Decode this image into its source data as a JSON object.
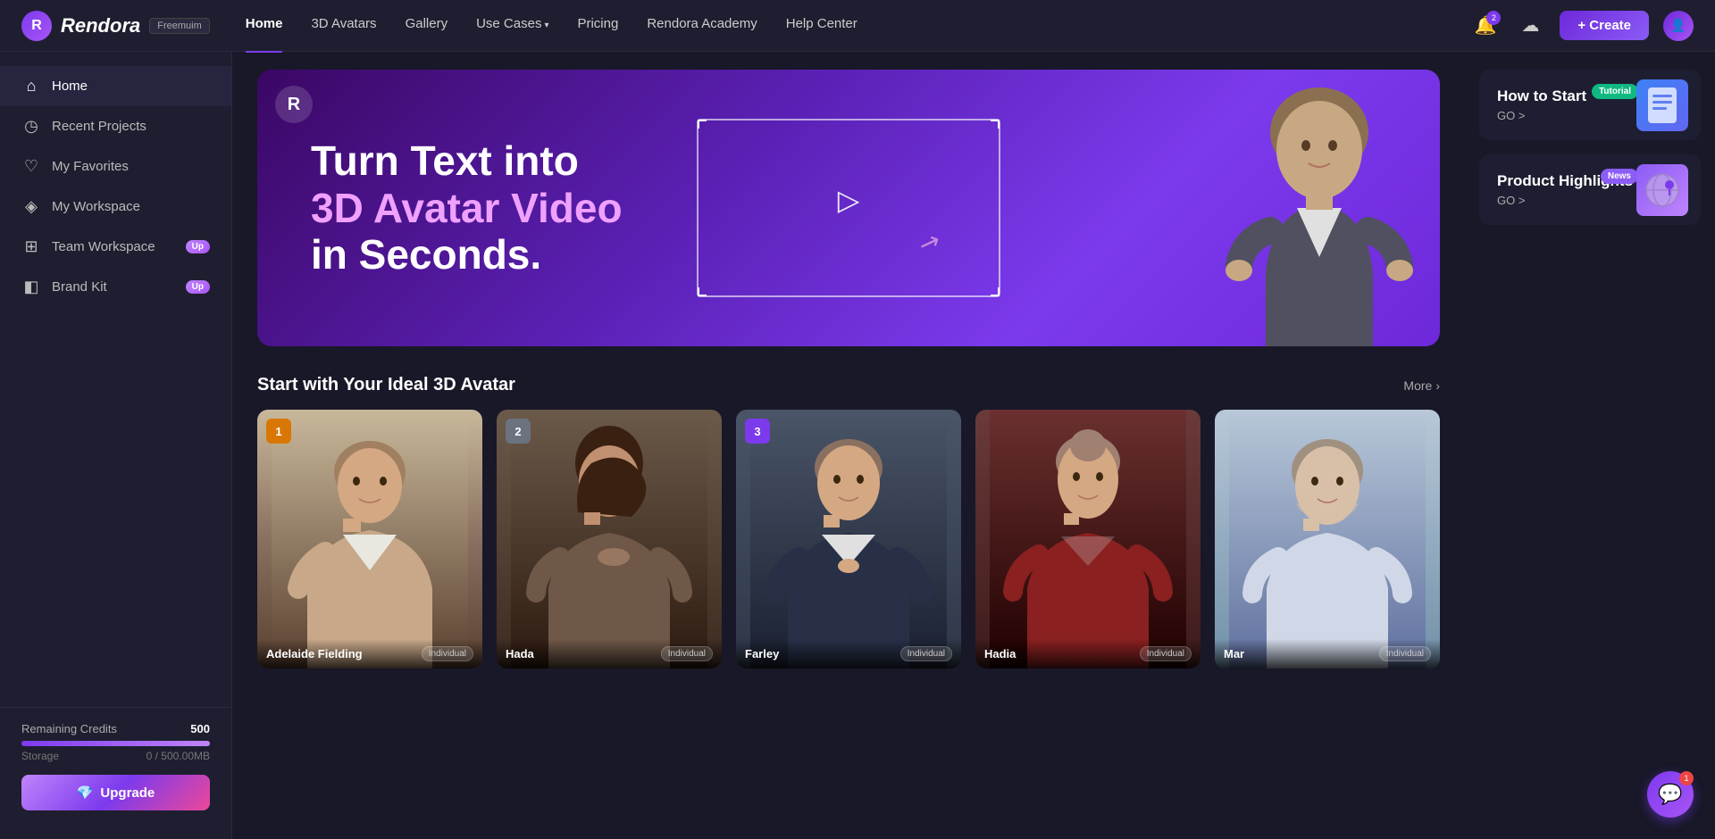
{
  "logo": {
    "icon": "R",
    "text": "Rendora",
    "badge": "Freemuim"
  },
  "nav": {
    "links": [
      {
        "label": "Home",
        "active": true
      },
      {
        "label": "3D Avatars",
        "active": false
      },
      {
        "label": "Gallery",
        "active": false
      },
      {
        "label": "Use Cases",
        "active": false,
        "hasChevron": true
      },
      {
        "label": "Pricing",
        "active": false
      },
      {
        "label": "Rendora Academy",
        "active": false
      },
      {
        "label": "Help Center",
        "active": false
      }
    ],
    "notif_count": "2",
    "create_label": "+ Create"
  },
  "sidebar": {
    "items": [
      {
        "label": "Home",
        "icon": "⌂",
        "active": true
      },
      {
        "label": "Recent Projects",
        "icon": "◷",
        "active": false
      },
      {
        "label": "My Favorites",
        "icon": "♡",
        "active": false
      },
      {
        "label": "My Workspace",
        "icon": "◈",
        "active": false
      },
      {
        "label": "Team Workspace",
        "icon": "⊞",
        "active": false,
        "badge": "Up"
      },
      {
        "label": "Brand Kit",
        "icon": "◧",
        "active": false,
        "badge": "Up"
      }
    ],
    "credits_label": "Remaining Credits",
    "credits_value": "500",
    "storage_label": "Storage",
    "storage_value": "0 / 500.00MB",
    "upgrade_label": "Upgrade"
  },
  "hero": {
    "title_line1": "Turn Text into",
    "title_line2": "3D Avatar Video",
    "title_line3": "in Seconds."
  },
  "right_panel": {
    "how_to_start": {
      "title": "How to Start",
      "badge": "Tutorial",
      "go_label": "GO >"
    },
    "product_highlights": {
      "title": "Product Highlights",
      "badge": "News",
      "go_label": "GO >"
    }
  },
  "avatars_section": {
    "title": "Start with Your Ideal 3D Avatar",
    "more_label": "More",
    "avatars": [
      {
        "rank": "1",
        "rank_class": "rank-gold",
        "name": "Adelaide Fielding",
        "type": "Individual",
        "bg": "bg-adelaide"
      },
      {
        "rank": "2",
        "rank_class": "rank-silver",
        "name": "Hada",
        "type": "Individual",
        "bg": "bg-hada"
      },
      {
        "rank": "3",
        "rank_class": "rank-purple",
        "name": "Farley",
        "type": "Individual",
        "bg": "bg-farley"
      },
      {
        "rank": "",
        "name": "Hadia",
        "type": "Individual",
        "bg": "bg-hadia"
      },
      {
        "rank": "",
        "name": "Mar",
        "type": "Individual",
        "bg": "bg-mar"
      }
    ]
  },
  "chat": {
    "notif": "1"
  }
}
